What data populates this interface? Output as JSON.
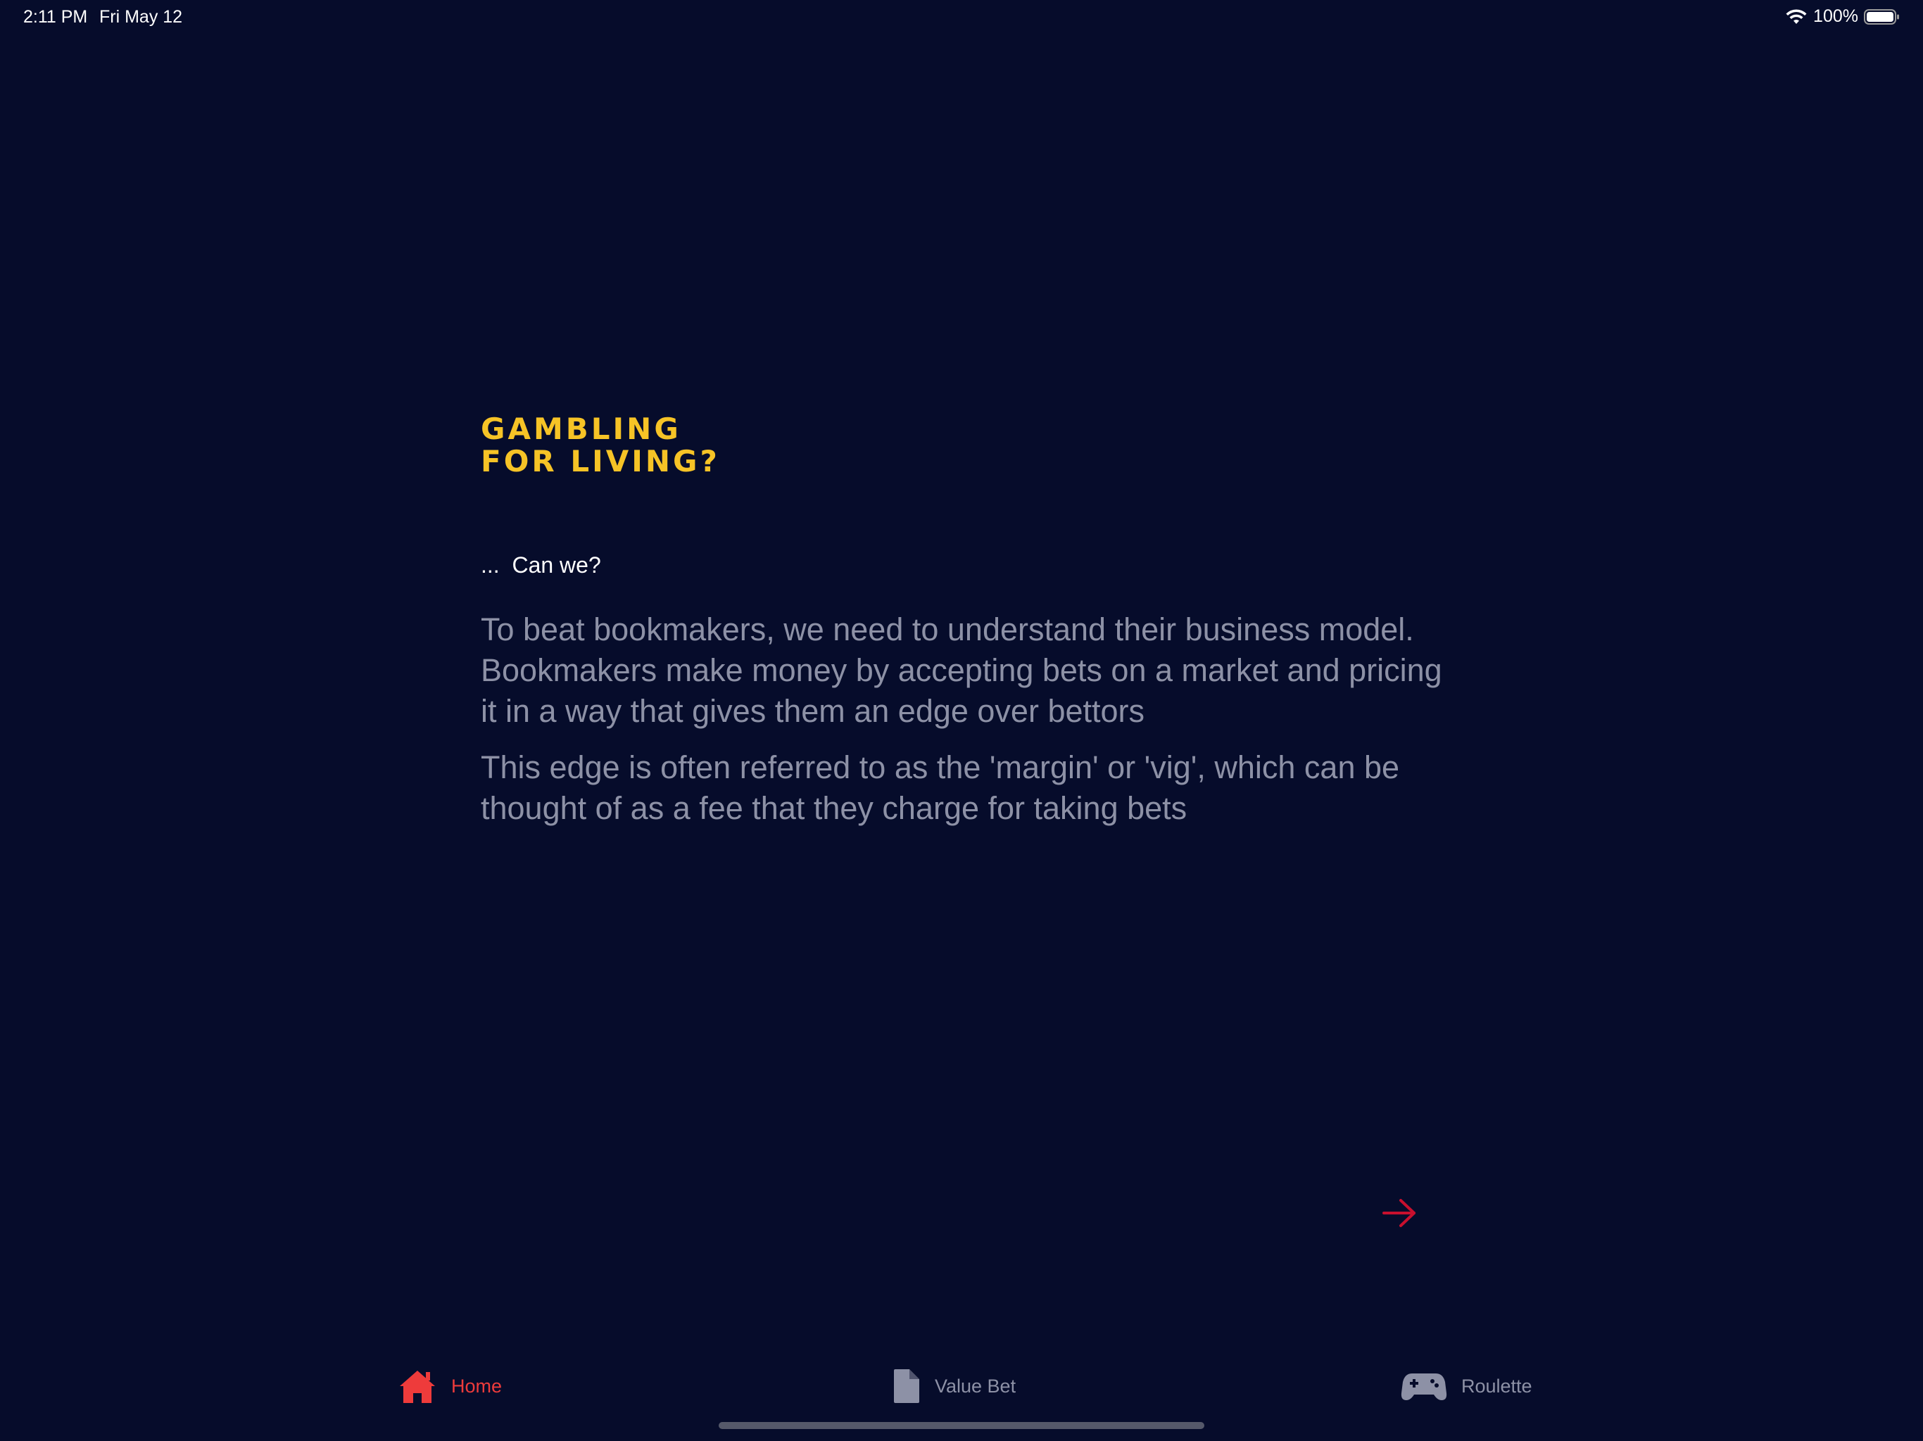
{
  "status_bar": {
    "time": "2:11 PM",
    "date": "Fri May 12",
    "battery": "100%"
  },
  "content": {
    "title_line1": "GAMBLING",
    "title_line2": "FOR LIVING?",
    "tagline": "...  Can we?",
    "paragraph1": "To beat bookmakers, we need to understand their business model. Bookmakers make money by accepting bets on a market and pricing it in a way that gives them an edge over bettors",
    "paragraph2": "This edge is often referred to as the 'margin' or 'vig', which can be thought of as a fee that they charge for taking bets"
  },
  "tabs": [
    {
      "label": "Home",
      "icon": "house-icon",
      "active": true
    },
    {
      "label": "Value Bet",
      "icon": "document-icon",
      "active": false
    },
    {
      "label": "Roulette",
      "icon": "gamepad-icon",
      "active": false
    }
  ],
  "colors": {
    "background": "#060c2b",
    "title": "#f6c326",
    "body_text": "#8d91a6",
    "accent": "#ee3b3b",
    "arrow": "#c8102e"
  }
}
